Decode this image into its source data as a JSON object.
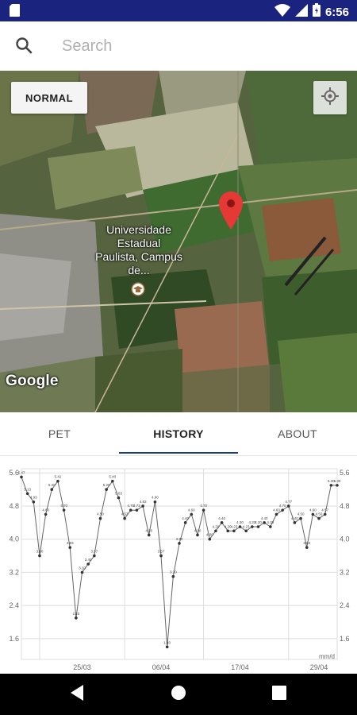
{
  "status_bar": {
    "time": "6:56",
    "icons": [
      "sd-card-icon",
      "wifi-icon",
      "signal-icon",
      "battery-icon"
    ]
  },
  "search": {
    "placeholder": "Search",
    "value": ""
  },
  "map": {
    "map_type_label": "NORMAL",
    "place_label": "Universidade Estadual Paulista, Campus de...",
    "watermark": "Google",
    "colors": {
      "marker": "#e53935"
    }
  },
  "tabs": [
    {
      "label": "PET",
      "active": false
    },
    {
      "label": "HISTORY",
      "active": true
    },
    {
      "label": "ABOUT",
      "active": false
    }
  ],
  "colors": {
    "status_bar": "#1a237e",
    "tab_indicator": "#1a3f8a",
    "chart_line": "#666666"
  },
  "chart_data": {
    "type": "line",
    "title": "",
    "xlabel": "",
    "ylabel": "mm/d",
    "ylim": [
      1.1,
      5.7
    ],
    "yticks": [
      "1.6",
      "2.4",
      "3.2",
      "4.0",
      "4.8",
      "5.6"
    ],
    "xticks": [
      "25/03",
      "06/04",
      "17/04",
      "29/04"
    ],
    "grid": true,
    "legend": "none",
    "series": [
      {
        "values": [
          5.5,
          5.1,
          4.9,
          3.6,
          4.6,
          5.2,
          5.4,
          4.7,
          3.8,
          2.1,
          3.2,
          3.4,
          3.6,
          4.5,
          5.2,
          5.4,
          5.0,
          4.5,
          4.7,
          4.7,
          4.8,
          4.1,
          4.9,
          3.6,
          1.4,
          3.1,
          3.9,
          4.4,
          4.6,
          4.1,
          4.7,
          4.0,
          4.2,
          4.4,
          4.2,
          4.2,
          4.3,
          4.2,
          4.3,
          4.3,
          4.4,
          4.3,
          4.6,
          4.7,
          4.8,
          4.4,
          4.5,
          3.8,
          4.6,
          4.5,
          4.6,
          5.3,
          5.3
        ],
        "labels": [
          "5.47",
          "5.13",
          "4.93",
          "3.60",
          "4.60",
          "5.20",
          "5.42",
          "4.70",
          "3.83",
          "2.10",
          "3.20",
          "3.40",
          "3.57",
          "4.50",
          "5.20",
          "5.40",
          "5.03",
          "4.53",
          "4.70",
          "4.73",
          "4.83",
          "4.10",
          "4.90",
          "3.57",
          "1.40",
          "3.10",
          "3.90",
          "4.40",
          "4.60",
          "4.10",
          "4.70",
          "4.00",
          "4.20",
          "4.40",
          "4.20",
          "4.23",
          "4.30",
          "4.23",
          "4.33",
          "4.30",
          "4.40",
          "4.33",
          "4.60",
          "4.70",
          "4.77",
          "4.40",
          "4.50",
          "3.83",
          "4.60",
          "4.50",
          "4.57",
          "5.30",
          "5.30"
        ]
      }
    ]
  }
}
